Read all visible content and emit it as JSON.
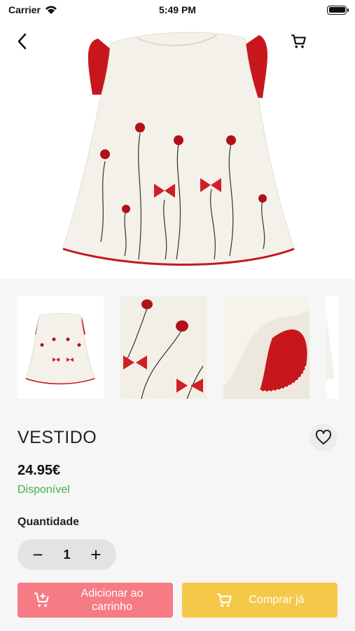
{
  "status_bar": {
    "carrier": "Carrier",
    "time": "5:49 PM"
  },
  "product": {
    "name": "VESTIDO",
    "price": "24.95€",
    "availability": "Disponível"
  },
  "quantity": {
    "label": "Quantidade",
    "value": "1",
    "minus": "−",
    "plus": "+"
  },
  "actions": {
    "add_to_cart": "Adicionar ao carrinho",
    "buy_now": "Comprar já"
  },
  "colors": {
    "accent_red": "#f67b84",
    "accent_yellow": "#f5c84a",
    "available_green": "#43b04a"
  },
  "icons": [
    "wifi-icon",
    "battery-icon",
    "back-arrow-icon",
    "cart-icon",
    "heart-icon",
    "add-cart-icon",
    "cart-icon"
  ]
}
